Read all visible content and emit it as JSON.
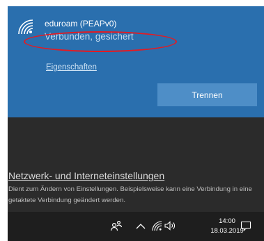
{
  "network": {
    "name": "eduroam (PEAPv0)",
    "status": "Verbunden, gesichert",
    "properties_link": "Eigenschaften",
    "disconnect_label": "Trennen",
    "icon": "wifi-icon"
  },
  "settings": {
    "link": "Netzwerk- und Interneteinstellungen",
    "description": "Dient zum Ändern von Einstellungen. Beispielsweise kann eine Verbindung in eine getaktete Verbindung geändert werden."
  },
  "taskbar": {
    "time": "14:00",
    "date": "18.03.2019",
    "icons": [
      "people-icon",
      "chevron-up-icon",
      "wifi-icon",
      "speaker-icon",
      "notification-icon"
    ]
  },
  "colors": {
    "card": "#2a6fae",
    "button": "#4e8ec7",
    "flyout": "#2b2b2b",
    "taskbar": "#1e1e1e",
    "annotation": "#e31b23"
  }
}
